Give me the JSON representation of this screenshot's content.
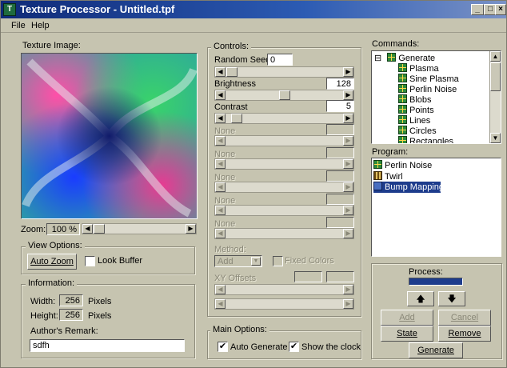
{
  "window": {
    "title": "Texture Processor - Untitled.tpf",
    "app_icon": "T",
    "minimize_glyph": "_",
    "maximize_glyph": "□",
    "close_glyph": "×"
  },
  "menu": {
    "file": "File",
    "help": "Help"
  },
  "texture": {
    "label": "Texture Image:"
  },
  "zoom": {
    "label": "Zoom:",
    "value": "100 %"
  },
  "view_options": {
    "title": "View Options:",
    "auto_zoom": "Auto Zoom",
    "look_buffer": "Look Buffer",
    "look_buffer_checked": false
  },
  "information": {
    "title": "Information:",
    "width_label": "Width:",
    "width_value": "256",
    "width_unit": "Pixels",
    "height_label": "Height:",
    "height_value": "256",
    "height_unit": "Pixels",
    "remark_label": "Author's Remark:",
    "remark_value": "sdfh"
  },
  "controls": {
    "title": "Controls:",
    "random_seed_label": "Random Seed:",
    "random_seed_value": "0",
    "brightness_label": "Brightness",
    "brightness_value": "128",
    "contrast_label": "Contrast",
    "contrast_value": "5",
    "none_label": "None",
    "method_label": "Method:",
    "method_value": "Add",
    "fixed_colors": "Fixed Colors",
    "xy_offsets": "XY Offsets"
  },
  "main_options": {
    "title": "Main Options:",
    "auto_generate": "Auto Generate",
    "show_clock": "Show the clock",
    "auto_generate_checked": true,
    "show_clock_checked": true
  },
  "commands": {
    "title": "Commands:",
    "root": "Generate",
    "expander": "⊟",
    "items": [
      "Plasma",
      "Sine Plasma",
      "Perlin Noise",
      "Blobs",
      "Points",
      "Lines",
      "Circles",
      "Rectangles"
    ]
  },
  "program": {
    "title": "Program:",
    "items": [
      "Perlin Noise",
      "Twirl",
      "Bump Mapping"
    ],
    "selected": "Bump Mapping"
  },
  "process": {
    "title": "Process:",
    "up_glyph": "🡅",
    "down_glyph": "🡇",
    "add": "Add",
    "cancel": "Cancel",
    "state": "State",
    "remove": "Remove",
    "generate": "Generate"
  },
  "glyphs": {
    "left": "◀",
    "right": "▶",
    "up": "▲",
    "down": "▼",
    "check": "✔",
    "dropdown": "▼"
  },
  "colors": {
    "title_start": "#0f2a78",
    "title_end": "#7a92c6",
    "selection": "#1d3c8c",
    "face": "#c6c4b0"
  }
}
